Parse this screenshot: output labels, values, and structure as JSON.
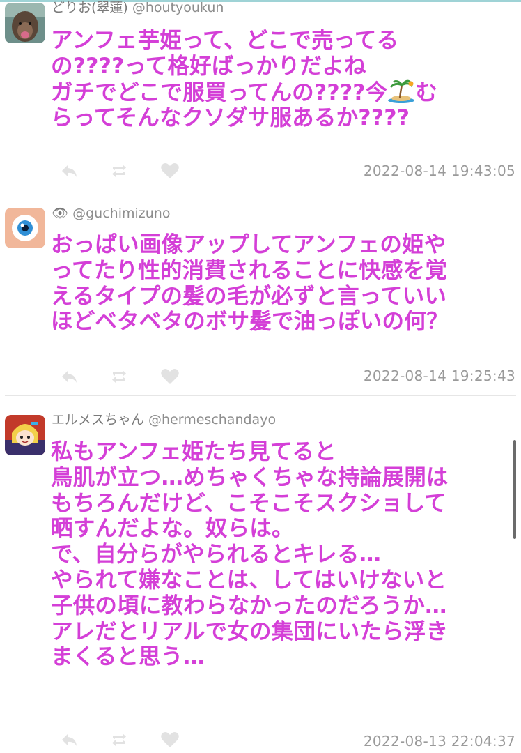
{
  "tweets": [
    {
      "display_name": "どりお(翠蓮)",
      "handle": "@houtyoukun",
      "lines": [
        "アンフェ芋姫って、どこで売ってる",
        "の????って格好ばっかりだよね",
        "ガチでどこで服買ってんの????今",
        "らってそんなクソダサ服あるか????"
      ],
      "line3_after_emoji": "む",
      "emoji": "desert-island-icon",
      "timestamp": "2022-08-14 19:43:05"
    },
    {
      "display_name": "👁",
      "handle": "@guchimizuno",
      "lines": [
        "おっぱい画像アップしてアンフェの姫や",
        "ってたり性的消費されることに快感を覚",
        "えるタイプの髪の毛が必ずと言っていい",
        "ほどベタベタのボサ髪で油っぽいの何？"
      ],
      "timestamp": "2022-08-14 19:25:43"
    },
    {
      "display_name": "エルメスちゃん",
      "handle": "@hermeschandayo",
      "lines": [
        "私もアンフェ姫たち見てると",
        "鳥肌が立つ…めちゃくちゃな持論展開は",
        "もちろんだけど、こそこそスクショして",
        "晒すんだよな。奴らは。",
        "で、自分らがやられるとキレる…",
        "やられて嫌なことは、してはいけないと",
        "子供の頃に教わらなかったのだろうか…",
        "アレだとリアルで女の集団にいたら浮き",
        "まくると思う…"
      ],
      "timestamp": "2022-08-13 22:04:37"
    }
  ],
  "colors": {
    "tweet_text": "#d43fd7",
    "meta_text": "#8d8d8d",
    "action_icon": "#e2e2e2",
    "divider": "#e6e6e6"
  }
}
